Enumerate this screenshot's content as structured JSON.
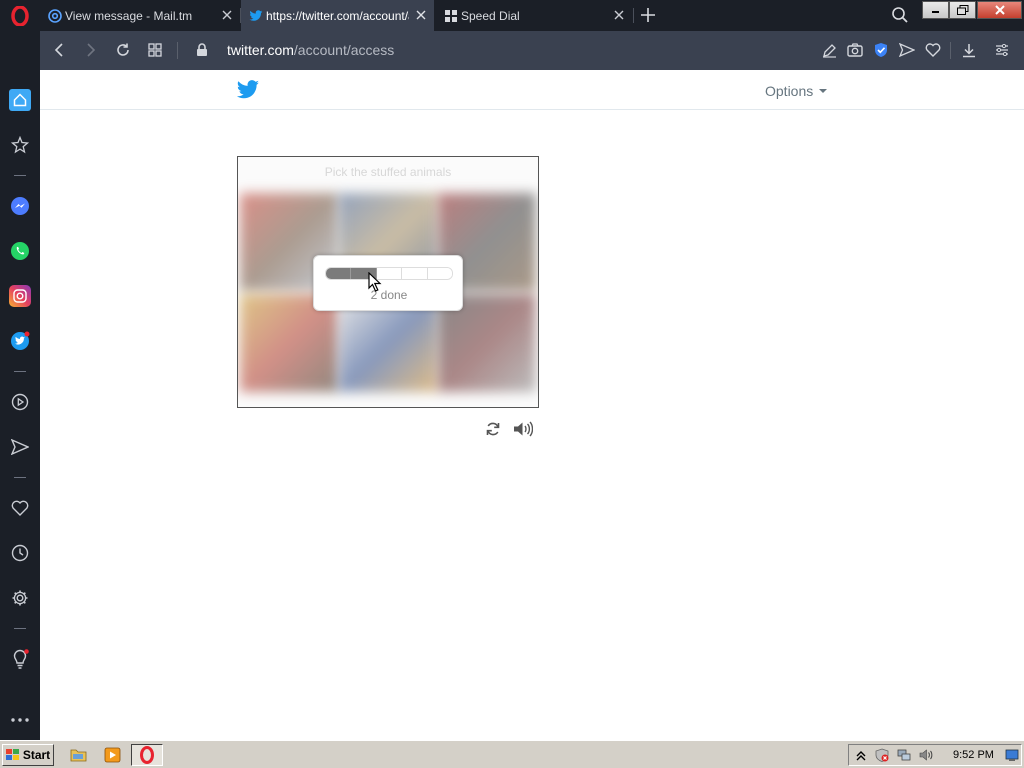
{
  "browser": {
    "tabs": [
      {
        "title": "View message - Mail.tm",
        "active": false,
        "favicon": "mail-tm-at-icon"
      },
      {
        "title": "https://twitter.com/account/access",
        "active": true,
        "favicon": "twitter-bird-icon"
      },
      {
        "title": "Speed Dial",
        "active": false,
        "favicon": "speed-dial-grid-icon"
      }
    ],
    "url_host": "twitter.com",
    "url_path": "/account/access",
    "accent_color": "#3a4150",
    "sidebar_icons": [
      "home-icon",
      "bookmarks-icon",
      "messenger-icon",
      "whatsapp-icon",
      "instagram-icon",
      "twitter-icon",
      "player-icon",
      "send-icon",
      "heart-icon",
      "history-icon",
      "settings-icon",
      "lightbulb-icon",
      "more-icon"
    ]
  },
  "page": {
    "header": {
      "options_label": "Options"
    },
    "captcha": {
      "instruction": "Pick the stuffed animals",
      "progress_done": 2,
      "progress_total": 5,
      "progress_label": "2 done"
    }
  },
  "taskbar": {
    "start_label": "Start",
    "clock": "9:52 PM"
  }
}
